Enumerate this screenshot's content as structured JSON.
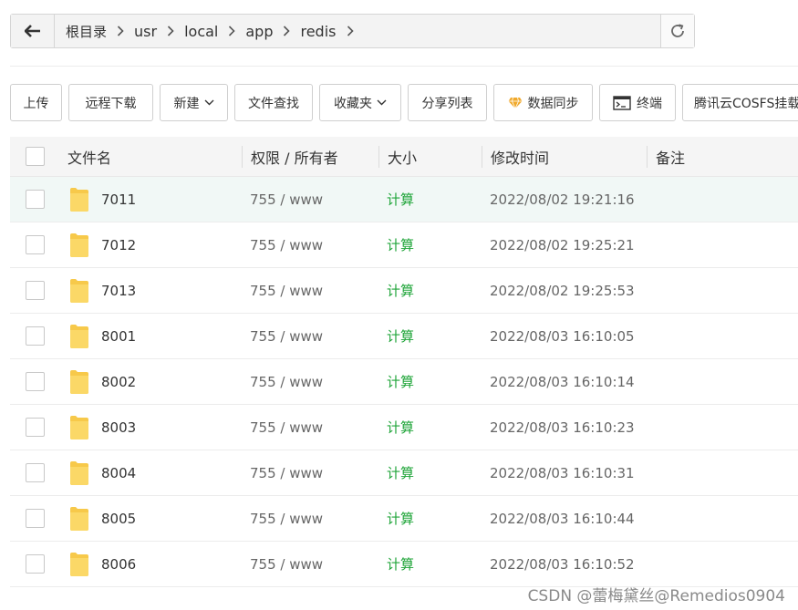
{
  "path": {
    "crumbs": [
      "根目录",
      "usr",
      "local",
      "app",
      "redis"
    ]
  },
  "toolbar": {
    "upload": "上传",
    "remote_download": "远程下载",
    "new": "新建",
    "file_search": "文件查找",
    "favorites": "收藏夹",
    "share_list": "分享列表",
    "data_sync": "数据同步",
    "terminal": "终端",
    "cosfs": "腾讯云COSFS挂载"
  },
  "table": {
    "headers": {
      "name": "文件名",
      "perm": "权限 / 所有者",
      "size": "大小",
      "time": "修改时间",
      "note": "备注"
    },
    "rows": [
      {
        "name": "7011",
        "perm": "755 / www",
        "size": "计算",
        "time": "2022/08/02 19:21:16"
      },
      {
        "name": "7012",
        "perm": "755 / www",
        "size": "计算",
        "time": "2022/08/02 19:25:21"
      },
      {
        "name": "7013",
        "perm": "755 / www",
        "size": "计算",
        "time": "2022/08/02 19:25:53"
      },
      {
        "name": "8001",
        "perm": "755 / www",
        "size": "计算",
        "time": "2022/08/03 16:10:05"
      },
      {
        "name": "8002",
        "perm": "755 / www",
        "size": "计算",
        "time": "2022/08/03 16:10:14"
      },
      {
        "name": "8003",
        "perm": "755 / www",
        "size": "计算",
        "time": "2022/08/03 16:10:23"
      },
      {
        "name": "8004",
        "perm": "755 / www",
        "size": "计算",
        "time": "2022/08/03 16:10:31"
      },
      {
        "name": "8005",
        "perm": "755 / www",
        "size": "计算",
        "time": "2022/08/03 16:10:44"
      },
      {
        "name": "8006",
        "perm": "755 / www",
        "size": "计算",
        "time": "2022/08/03 16:10:52"
      }
    ]
  },
  "watermark": "CSDN @蕾梅黛丝@Remedios0904",
  "colors": {
    "size_link": "#20a53a",
    "row_highlight": "#f1f8f6",
    "folder": "#f7c94a",
    "sync_icon": "#f0a92c"
  },
  "icons": {
    "back": "arrow-left-icon",
    "refresh": "refresh-icon",
    "crumb_separator": "chevron-right-icon",
    "folder": "folder-icon",
    "data_sync": "diamond-icon",
    "terminal": "terminal-icon",
    "dropdown": "chevron-down-icon"
  }
}
